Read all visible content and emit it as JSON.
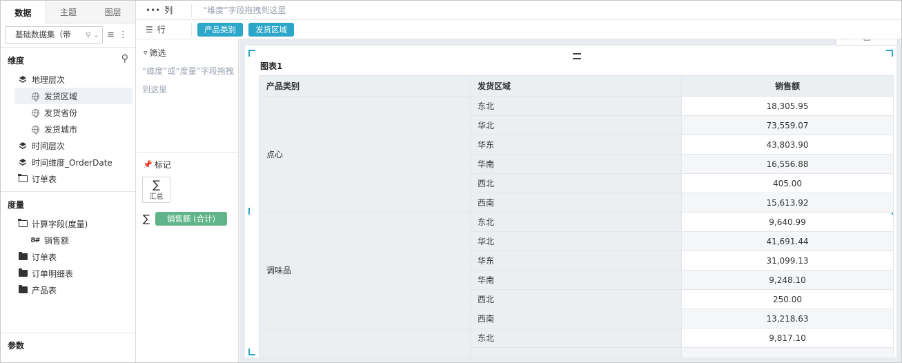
{
  "left_panel": {
    "tabs": [
      {
        "label": "数据",
        "active": true
      },
      {
        "label": "主题",
        "active": false
      },
      {
        "label": "图层",
        "active": false
      }
    ],
    "dataset": {
      "value": "基础数据集（带",
      "icon": "search-icon"
    },
    "dimensions_title": "维度",
    "dimension_items": [
      {
        "label": "地理层次",
        "icon": "layers-icon",
        "level": 1
      },
      {
        "label": "发货区域",
        "icon": "globe-icon",
        "level": 2,
        "selected": true
      },
      {
        "label": "发货省份",
        "icon": "globe-icon",
        "level": 2
      },
      {
        "label": "发货城市",
        "icon": "globe-icon",
        "level": 2
      },
      {
        "label": "时间层次",
        "icon": "layers-icon",
        "level": 1
      },
      {
        "label": "时间维度_OrderDate",
        "icon": "layers-icon",
        "level": 1
      },
      {
        "label": "订单表",
        "icon": "folder-open-icon",
        "level": 1
      }
    ],
    "measures_title": "度量",
    "measure_items": [
      {
        "label": "计算字段(度量)",
        "icon": "folder-open-icon",
        "level": 1
      },
      {
        "label": "销售额",
        "icon": "hash-icon",
        "level": 2
      },
      {
        "label": "订单表",
        "icon": "folder-icon",
        "level": 1
      },
      {
        "label": "订单明细表",
        "icon": "folder-icon",
        "level": 1
      },
      {
        "label": "产品表",
        "icon": "folder-icon",
        "level": 1
      }
    ],
    "params_title": "参数"
  },
  "shelves": {
    "columns": {
      "label": "列",
      "hint": "“维度”字段拖拽到这里"
    },
    "rows": {
      "label": "行",
      "pills": [
        "产品类别",
        "发货区域"
      ]
    }
  },
  "mid_panel": {
    "filter_title": "筛选",
    "filter_hint": "“维度”或“度量”字段拖拽到这里",
    "mark_title": "标记",
    "sum_label": "汇总",
    "measure_pill": "销售额 (合计)"
  },
  "chart": {
    "title": "图表1",
    "headers": [
      "产品类别",
      "发货区域",
      "销售额"
    ],
    "groups": [
      {
        "category": "点心",
        "rows": [
          {
            "region": "东北",
            "value": "18,305.95"
          },
          {
            "region": "华北",
            "value": "73,559.07"
          },
          {
            "region": "华东",
            "value": "43,803.90"
          },
          {
            "region": "华南",
            "value": "16,556.88"
          },
          {
            "region": "西北",
            "value": "405.00"
          },
          {
            "region": "西南",
            "value": "15,613.92"
          }
        ]
      },
      {
        "category": "调味品",
        "rows": [
          {
            "region": "东北",
            "value": "9,640.99"
          },
          {
            "region": "华北",
            "value": "41,691.44"
          },
          {
            "region": "华东",
            "value": "31,099.13"
          },
          {
            "region": "华南",
            "value": "9,248.10"
          },
          {
            "region": "西北",
            "value": "250.00"
          },
          {
            "region": "西南",
            "value": "13,218.63"
          }
        ]
      },
      {
        "category": "",
        "rows": [
          {
            "region": "东北",
            "value": "9,817.10"
          },
          {
            "region": "",
            "value": ""
          }
        ]
      }
    ]
  },
  "colors": {
    "accent_blue": "#2ca6c9",
    "measure_green": "#5fb589"
  }
}
